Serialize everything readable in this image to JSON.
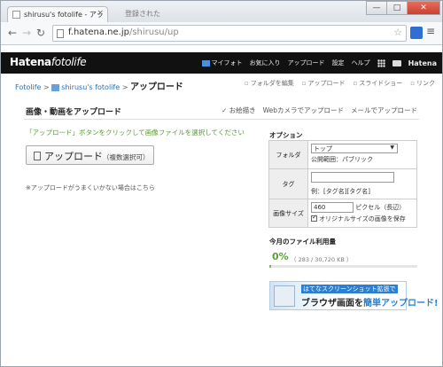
{
  "browser": {
    "active_tab_title": "shirusu's fotolife - アッ",
    "inactive_tab_title": "登録された",
    "tab_close": "×",
    "url_host": "f.hatena.ne.jp",
    "url_path": "/shirusu/up",
    "min_glyph": "—",
    "max_glyph": "□",
    "close_glyph": "✕"
  },
  "header": {
    "brand_a": "Hatena",
    "brand_b": "fotolife",
    "nav": [
      "マイフォト",
      "お気に入り",
      "アップロード",
      "設定",
      "ヘルプ"
    ],
    "hatena_logo": "Hatena"
  },
  "breadcrumb": {
    "root": "Fotolife",
    "user": "shirusu's fotolife",
    "sep": ">",
    "current": "アップロード"
  },
  "top_actions": [
    "フォルダを編集",
    "アップロード",
    "スライドショー",
    "リンク"
  ],
  "upload": {
    "title": "画像・動画をアップロード",
    "sources": [
      "✓ お絵描き",
      "Webカメラでアップロード",
      "メールでアップロード"
    ],
    "hint": "「アップロード」ボタンをクリックして画像ファイルを選択してください",
    "button_label": "アップロード",
    "button_sub": "（複数選択可）",
    "note": "※アップロードがうまくいかない場合はこちら"
  },
  "options": {
    "title": "オプション",
    "folder_label": "フォルダ",
    "folder_value": "トップ",
    "visibility": "公開範囲：パブリック",
    "tag_label": "タグ",
    "tag_example": "例：[タグ名][タグ名]",
    "size_label": "画像サイズ",
    "size_value": "460",
    "size_unit": "ピクセル（長辺）",
    "keep_original": "オリジナルサイズの画像を保存"
  },
  "usage": {
    "title": "今月のファイル利用量",
    "percent_text": "0%",
    "detail": "（ 283 / 30,720 KB ）",
    "fraction": 0.009
  },
  "banner": {
    "line1": "はてなスクリーンショット拡張で",
    "line2a": "ブラウザ画面を",
    "line2b": "簡単アップロード!"
  }
}
